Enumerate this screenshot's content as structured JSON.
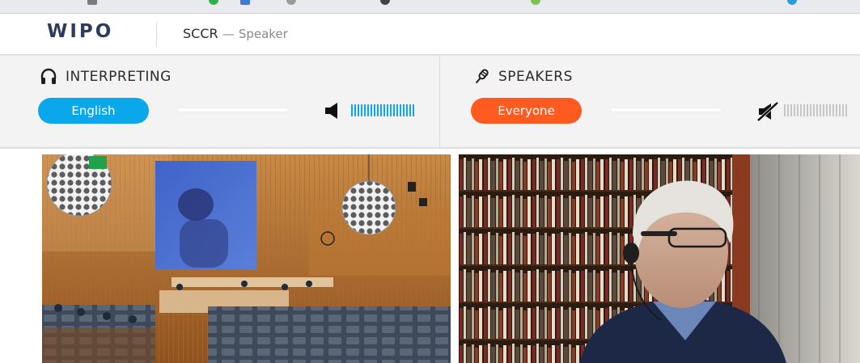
{
  "header": {
    "logo_text": "WIPO",
    "session_name": "SCCR",
    "separator": "—",
    "role": "Speaker"
  },
  "interpreting": {
    "heading": "INTERPRETING",
    "icon": "headphones-icon",
    "language_button": "English",
    "volume_icon": "speaker-icon",
    "meter_state": "active"
  },
  "speakers": {
    "heading": "SPEAKERS",
    "icon": "microphone-icon",
    "selection_button": "Everyone",
    "volume_icon": "speaker-muted-icon",
    "meter_state": "muted"
  },
  "colors": {
    "accent_blue": "#0aa7ea",
    "accent_orange": "#ff5a1f",
    "logo_navy": "#2d3b5e"
  },
  "videos": [
    {
      "name": "conference-room-feed"
    },
    {
      "name": "remote-speaker-feed"
    }
  ]
}
